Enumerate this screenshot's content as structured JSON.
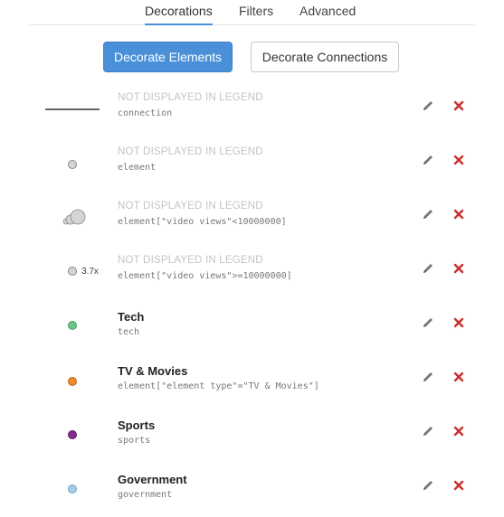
{
  "tabs": {
    "decorations": "Decorations",
    "filters": "Filters",
    "advanced": "Advanced"
  },
  "buttons": {
    "decorate_elements": "Decorate Elements",
    "decorate_connections": "Decorate Connections"
  },
  "colors": {
    "accent": "#4a90d9",
    "delete": "#c9302c",
    "tech": "#6cc48a",
    "tv_movies": "#f08a2a",
    "sports": "#8b2a8e",
    "government": "#a7cdea",
    "default_dot": "#d4d4d4"
  },
  "rows": [
    {
      "title": "NOT DISPLAYED IN LEGEND",
      "subtitle": "connection",
      "swatch": "line"
    },
    {
      "title": "NOT DISPLAYED IN LEGEND",
      "subtitle": "element",
      "swatch": "gray-dot"
    },
    {
      "title": "NOT DISPLAYED IN LEGEND",
      "subtitle": "element[\"video views\"<10000000]",
      "swatch": "size-bubbles"
    },
    {
      "title": "NOT DISPLAYED IN LEGEND",
      "subtitle": "element[\"video views\">=10000000]",
      "swatch": "scale-dot",
      "scale": "3.7x"
    },
    {
      "title": "Tech",
      "subtitle": "tech",
      "swatch": "color-dot"
    },
    {
      "title": "TV & Movies",
      "subtitle": "element[\"element type\"=\"TV & Movies\"]",
      "swatch": "color-dot"
    },
    {
      "title": "Sports",
      "subtitle": "sports",
      "swatch": "color-dot"
    },
    {
      "title": "Government",
      "subtitle": "government",
      "swatch": "color-dot"
    }
  ]
}
